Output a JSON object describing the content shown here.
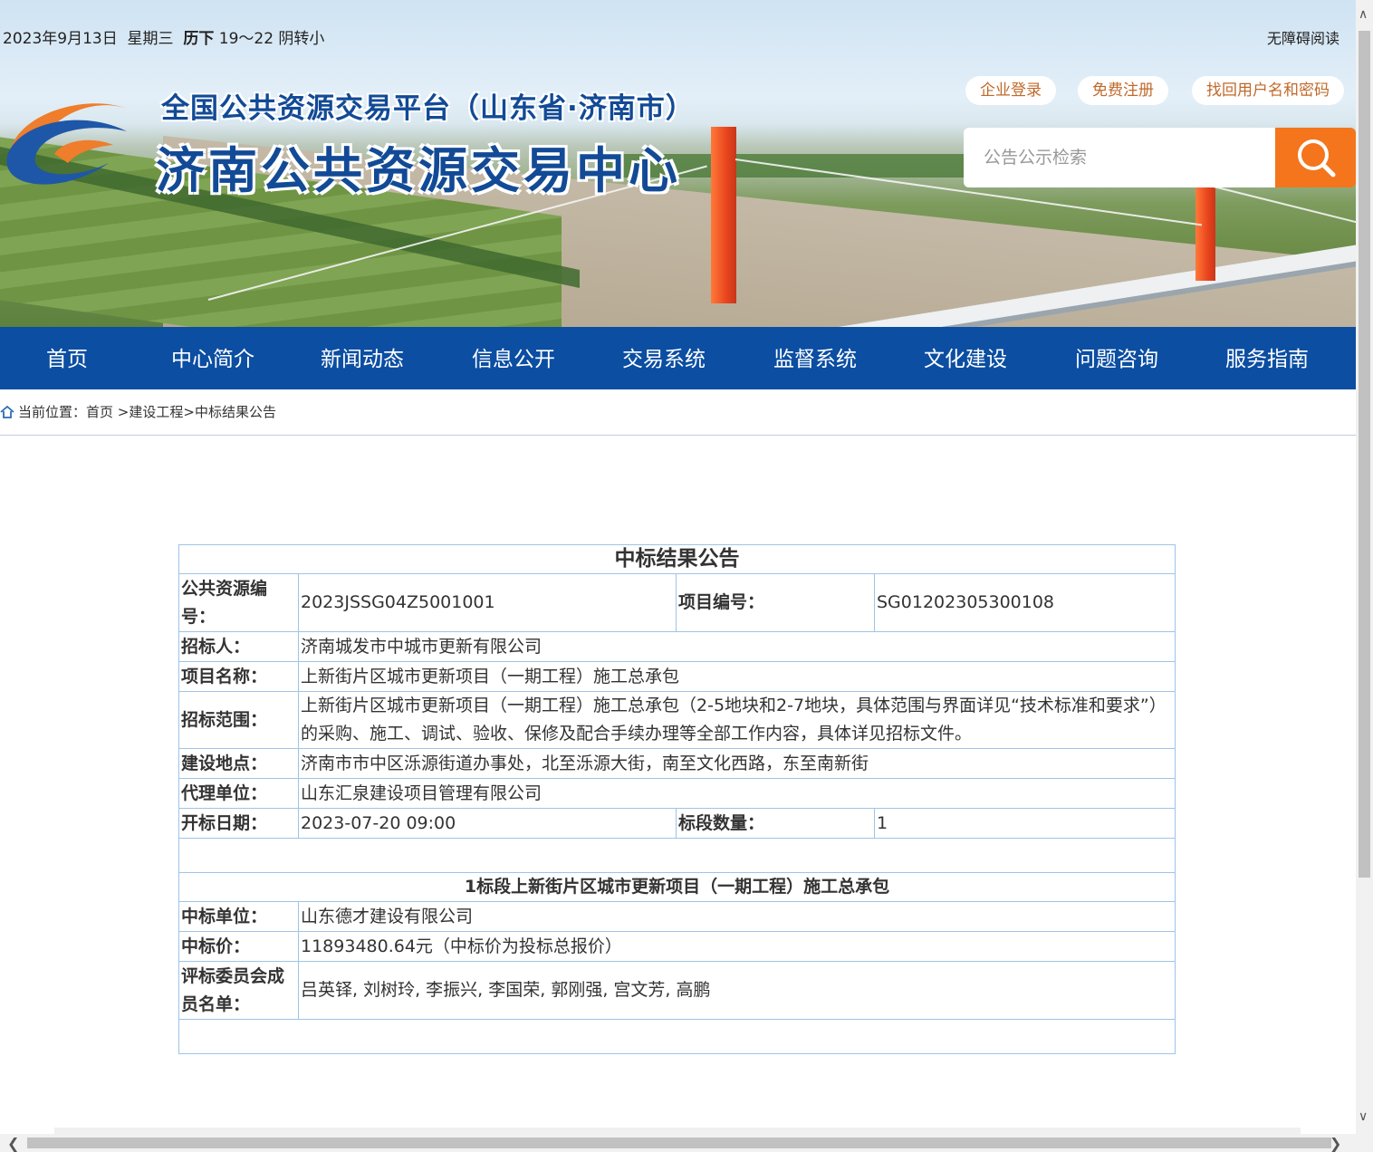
{
  "header": {
    "date": "2023年9月13日",
    "weekday": "星期三",
    "district": "历下",
    "weather": "19～22 阴转小",
    "accessible": "无障碍阅读",
    "subtitle": "全国公共资源交易平台（山东省·济南市）",
    "title": "济南公共资源交易中心",
    "login": "企业登录",
    "register": "免费注册",
    "recover": "找回用户名和密码",
    "search_placeholder": "公告公示检索"
  },
  "nav": [
    "首页",
    "中心简介",
    "新闻动态",
    "信息公开",
    "交易系统",
    "监督系统",
    "文化建设",
    "问题咨询",
    "服务指南"
  ],
  "breadcrumb": {
    "prefix": "当前位置：",
    "home": "首页",
    "level1": "建设工程",
    "level2": "中标结果公告"
  },
  "notice": {
    "title": "中标结果公告",
    "resource_no_label": "公共资源编号：",
    "resource_no": "2023JSSG04Z5001001",
    "project_no_label": "项目编号：",
    "project_no": "SG01202305300108",
    "tenderer_label": "招标人：",
    "tenderer": "济南城发市中城市更新有限公司",
    "project_name_label": "项目名称：",
    "project_name": "上新街片区城市更新项目（一期工程）施工总承包",
    "scope_label": "招标范围：",
    "scope": "上新街片区城市更新项目（一期工程）施工总承包（2-5地块和2-7地块，具体范围与界面详见“技术标准和要求”）的采购、施工、调试、验收、保修及配合手续办理等全部工作内容，具体详见招标文件。",
    "location_label": "建设地点：",
    "location": "济南市市中区泺源街道办事处，北至泺源大街，南至文化西路，东至南新街",
    "agent_label": "代理单位：",
    "agent": "山东汇泉建设项目管理有限公司",
    "open_date_label": "开标日期：",
    "open_date": "2023-07-20 09:00",
    "sections_label": "标段数量：",
    "sections": "1",
    "section_title": "1标段上新街片区城市更新项目（一期工程）施工总承包",
    "winner_label": "中标单位：",
    "winner": "山东德才建设有限公司",
    "price_label": "中标价：",
    "price": "11893480.64元（中标价为投标总报价）",
    "committee_label": "评标委员会成员名单：",
    "committee": "吕英铎, 刘树玲, 李振兴, 李国荣, 郭刚强, 宫文芳, 高鹏"
  },
  "colors": {
    "nav_bg": "#0b4ea2",
    "title_blue": "#124a96",
    "search_btn": "#f4751c",
    "table_border": "#9ec4e8"
  }
}
